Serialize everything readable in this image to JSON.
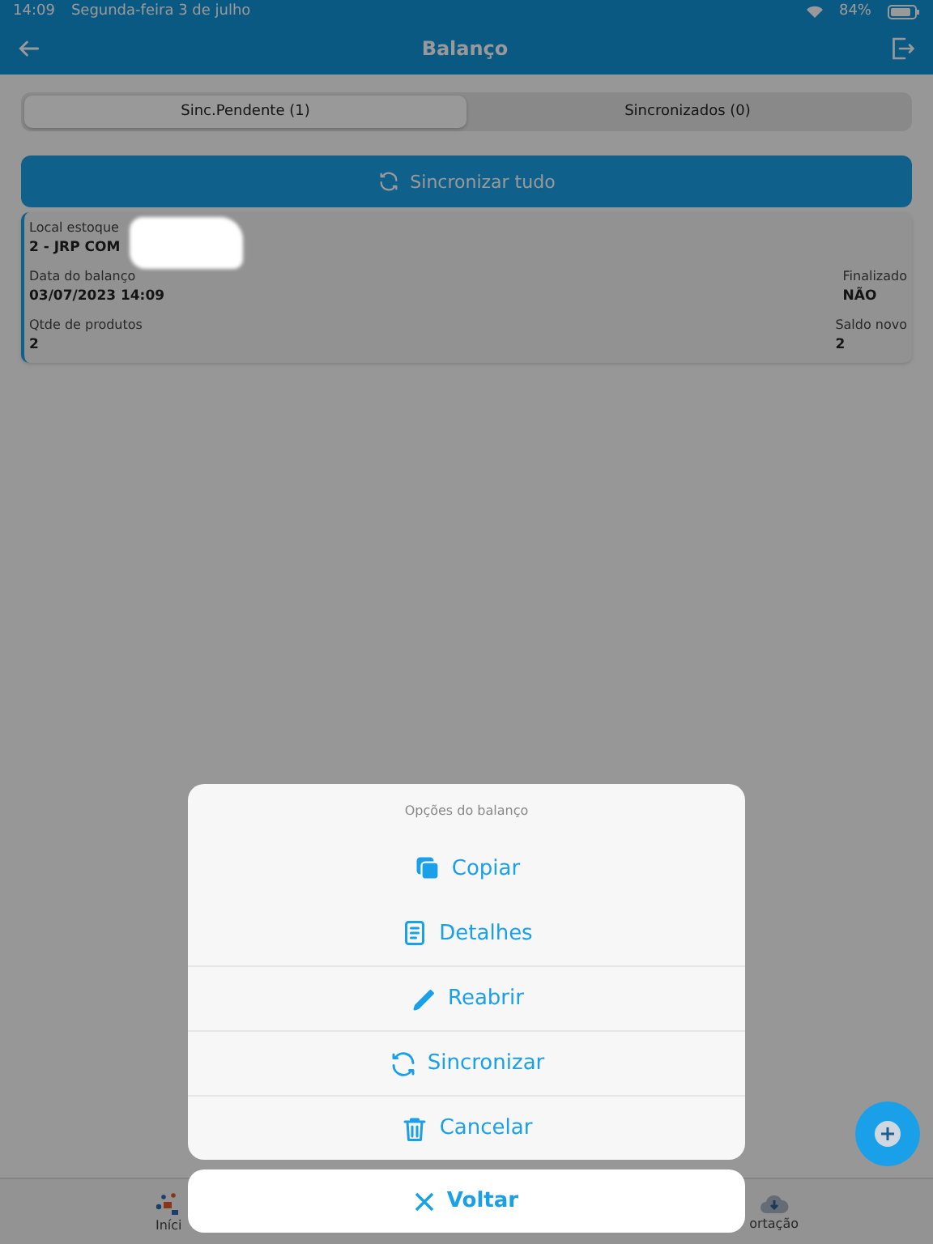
{
  "status_bar": {
    "time": "14:09",
    "date": "Segunda-feira 3 de julho",
    "battery": "84%"
  },
  "header": {
    "title": "Balanço"
  },
  "tabs": [
    {
      "label": "Sinc.Pendente (1)",
      "selected": true
    },
    {
      "label": "Sincronizados (0)",
      "selected": false
    }
  ],
  "sync_button": {
    "label": "Sincronizar tudo"
  },
  "records": [
    {
      "rows": [
        {
          "left": {
            "label": "Local estoque",
            "value": "2 - JRP COM"
          }
        },
        {
          "left": {
            "label": "Data do balanço",
            "value": "03/07/2023 14:09"
          },
          "right": {
            "label": "Finalizado",
            "value": "NÃO"
          }
        },
        {
          "left": {
            "label": "Qtde de produtos",
            "value": "2"
          },
          "right": {
            "label": "Saldo novo",
            "value": "2"
          }
        }
      ]
    }
  ],
  "bottom_nav": [
    {
      "label": "Iníci",
      "kind": "home"
    },
    {
      "label": "ortação",
      "kind": "import"
    }
  ],
  "sheet": {
    "title": "Opções do balanço",
    "actions": [
      {
        "label": "Copiar",
        "kind": "copy"
      },
      {
        "label": "Detalhes",
        "kind": "details"
      },
      {
        "label": "Reabrir",
        "kind": "edit"
      },
      {
        "label": "Sincronizar",
        "kind": "sync"
      },
      {
        "label": "Cancelar",
        "kind": "delete"
      }
    ],
    "cancel": {
      "label": "Voltar"
    }
  }
}
